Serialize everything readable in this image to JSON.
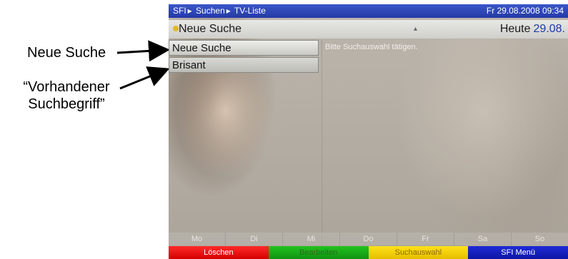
{
  "annotations": {
    "label_1": "Neue Suche",
    "label_2_line1": "“Vorhandener",
    "label_2_line2": "Suchbegriff”"
  },
  "topbar": {
    "crumbs": [
      "SFI",
      "Suchen",
      "TV-Liste"
    ],
    "datetime": "Fr 29.08.2008 09:34"
  },
  "header": {
    "title": "Neue Suche",
    "today_label": "Heute",
    "today_date": "29.08."
  },
  "list": {
    "items": [
      "Neue Suche",
      "Brisant"
    ],
    "selected_index": 0
  },
  "detail": {
    "hint": "Bitte Suchauswahl tätigen."
  },
  "days": [
    "Mo",
    "Di",
    "Mi",
    "Do",
    "Fr",
    "Sa",
    "So"
  ],
  "buttons": {
    "red": "Löschen",
    "green": "Bearbeiten",
    "yellow": "Suchauswahl",
    "blue": "SFI Menü"
  },
  "colors": {
    "topbar": "#2c44b8",
    "red": "#e00000",
    "green": "#1aa81a",
    "yellow": "#f2cc00",
    "blue": "#1420c0",
    "header_date": "#1e3aa8"
  }
}
